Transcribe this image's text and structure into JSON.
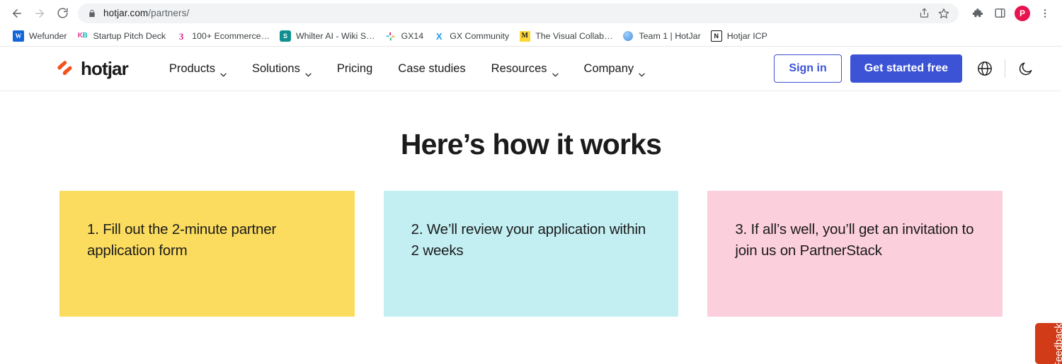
{
  "browser": {
    "back_label": "Back",
    "forward_label": "Forward",
    "reload_label": "Reload",
    "url_domain": "hotjar.com",
    "url_path": "/partners/",
    "lock_icon": "lock-icon",
    "share_icon": "share-icon",
    "bookmark_star_icon": "star-icon",
    "extensions_icon": "puzzle-icon",
    "side_panel_icon": "side-panel-icon",
    "menu_icon": "three-dot-menu-icon",
    "profile_initial": "P",
    "bookmarks": [
      {
        "label": "Wefunder",
        "icon": "wefunder-favicon",
        "glyph": "W"
      },
      {
        "label": "Startup Pitch Deck",
        "icon": "kb-favicon",
        "glyph": "KB"
      },
      {
        "label": "100+ Ecommerce…",
        "icon": "three-favicon",
        "glyph": "3"
      },
      {
        "label": "Whilter AI - Wiki S…",
        "icon": "sharepoint-favicon",
        "glyph": "S"
      },
      {
        "label": "GX14",
        "icon": "slack-favicon",
        "glyph": ""
      },
      {
        "label": "GX Community",
        "icon": "x-favicon",
        "glyph": "X"
      },
      {
        "label": "The Visual Collab…",
        "icon": "visual-collab-favicon",
        "glyph": "M"
      },
      {
        "label": "Team 1 | HotJar",
        "icon": "team-favicon",
        "glyph": ""
      },
      {
        "label": "Hotjar ICP",
        "icon": "notion-favicon",
        "glyph": "N"
      }
    ]
  },
  "site_nav": {
    "brand_name": "hotjar",
    "brand_mark_color": "#f5501c",
    "links": [
      {
        "label": "Products",
        "has_dropdown": true
      },
      {
        "label": "Solutions",
        "has_dropdown": true
      },
      {
        "label": "Pricing",
        "has_dropdown": false
      },
      {
        "label": "Case studies",
        "has_dropdown": false
      },
      {
        "label": "Resources",
        "has_dropdown": true
      },
      {
        "label": "Company",
        "has_dropdown": true
      }
    ],
    "sign_in_label": "Sign in",
    "get_started_label": "Get started free",
    "language_icon": "globe-icon",
    "theme_icon": "moon-icon",
    "accent_color": "#3c53d6"
  },
  "main": {
    "title": "Here’s how it works",
    "cards": [
      {
        "text": "1. Fill out the 2-minute partner application form",
        "color": "#fbdc5e"
      },
      {
        "text": "2. We’ll review your application within 2 weeks",
        "color": "#c3eff3"
      },
      {
        "text": "3. If all’s well, you’ll get an invitation to join us on PartnerStack",
        "color": "#fccfdd"
      }
    ]
  },
  "feedback_widget": {
    "label": "Feedback",
    "color": "#d13b17"
  }
}
